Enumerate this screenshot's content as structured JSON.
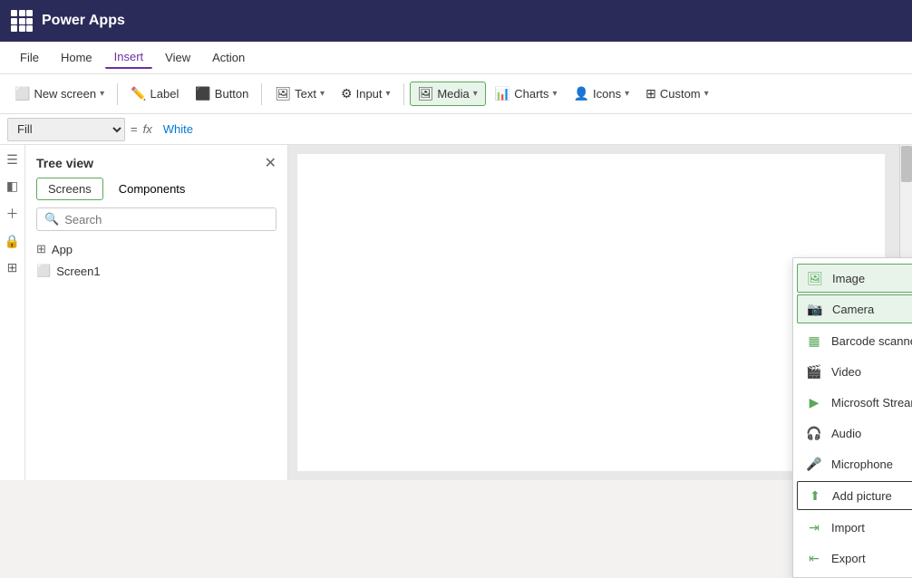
{
  "app": {
    "title": "Power Apps"
  },
  "menu": {
    "items": [
      {
        "label": "File",
        "active": false
      },
      {
        "label": "Home",
        "active": false
      },
      {
        "label": "Insert",
        "active": true
      },
      {
        "label": "View",
        "active": false
      },
      {
        "label": "Action",
        "active": false
      }
    ]
  },
  "toolbar": {
    "new_screen_label": "New screen",
    "label_label": "Label",
    "button_label": "Button",
    "text_label": "Text",
    "input_label": "Input",
    "media_label": "Media",
    "charts_label": "Charts",
    "icons_label": "Icons",
    "custom_label": "Custom"
  },
  "formula_bar": {
    "fill_label": "Fill",
    "equals": "=",
    "fx": "fx",
    "value": "White"
  },
  "sidebar": {
    "title": "Tree view",
    "tabs": [
      {
        "label": "Screens",
        "active": true
      },
      {
        "label": "Components",
        "active": false
      }
    ],
    "search_placeholder": "Search",
    "items": [
      {
        "label": "App",
        "type": "app"
      },
      {
        "label": "Screen1",
        "type": "screen"
      }
    ]
  },
  "media_dropdown": {
    "items": [
      {
        "label": "Image",
        "icon": "image",
        "highlighted": true
      },
      {
        "label": "Camera",
        "icon": "camera",
        "highlighted": true
      },
      {
        "label": "Barcode scanner",
        "icon": "barcode"
      },
      {
        "label": "Video",
        "icon": "video"
      },
      {
        "label": "Microsoft Stream",
        "icon": "stream"
      },
      {
        "label": "Audio",
        "icon": "audio"
      },
      {
        "label": "Microphone",
        "icon": "microphone"
      },
      {
        "label": "Add picture",
        "icon": "add-picture",
        "outlined": true
      },
      {
        "label": "Import",
        "icon": "import"
      },
      {
        "label": "Export",
        "icon": "export"
      }
    ]
  }
}
